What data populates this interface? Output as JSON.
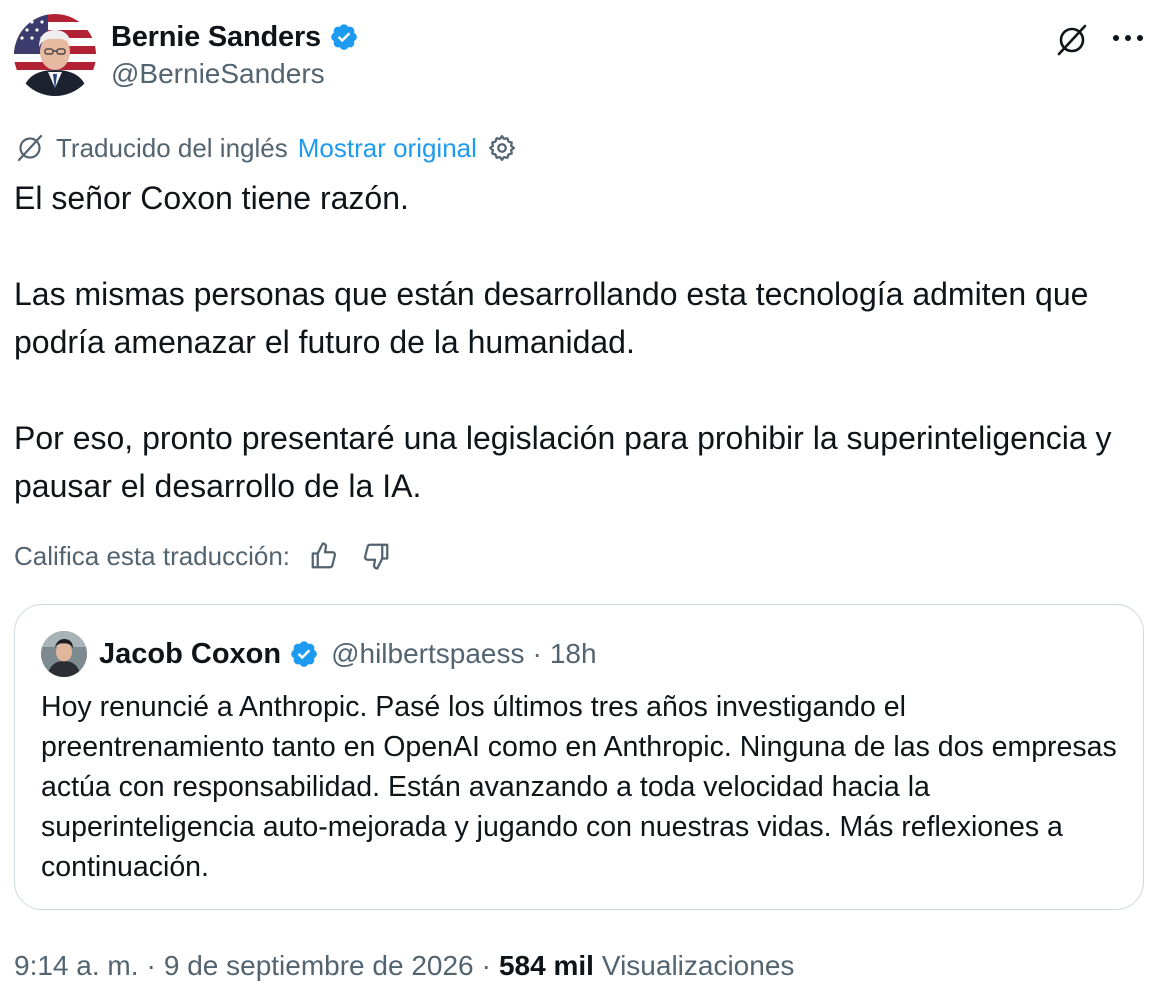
{
  "author": {
    "display_name": "Bernie Sanders",
    "handle": "@BernieSanders",
    "verified_color": "#1d9bf0"
  },
  "icons": {
    "translate": "translate-slash-icon",
    "more": "more-horizontal-icon",
    "settings": "gear-icon",
    "like": "thumbs-up-icon",
    "dislike": "thumbs-down-icon",
    "verified": "verified-badge-icon"
  },
  "translation": {
    "label": "Traducido del inglés",
    "show_original": "Mostrar original"
  },
  "tweet": {
    "paragraphs": [
      "El señor Coxon tiene razón.",
      "Las mismas personas que están desarrollando esta tecnología admiten que podría amenazar el futuro de la humanidad.",
      "Por eso, pronto presentaré una legislación para prohibir la superinteligencia y pausar el desarrollo de la IA."
    ]
  },
  "rate": {
    "label": "Califica esta traducción:"
  },
  "quote": {
    "display_name": "Jacob Coxon",
    "handle": "@hilbertspaess",
    "separator": "·",
    "time": "18h",
    "text": "Hoy renuncié a Anthropic. Pasé los últimos tres años investigando el preentrenamiento tanto en OpenAI como en Anthropic. Ninguna de las dos empresas actúa con responsabilidad. Están avanzando a toda velocidad hacia la superinteligencia auto-mejorada y jugando con nuestras vidas. Más reflexiones a continuación."
  },
  "meta": {
    "time": "9:14 a. m.",
    "sep1": "·",
    "date": "9 de septiembre de 2026",
    "sep2": "·",
    "views_count": "584 mil",
    "views_label": "Visualizaciones"
  },
  "colors": {
    "text": "#0f1419",
    "secondary": "#536471",
    "link": "#1d9bf0",
    "border": "#cfd9de"
  }
}
